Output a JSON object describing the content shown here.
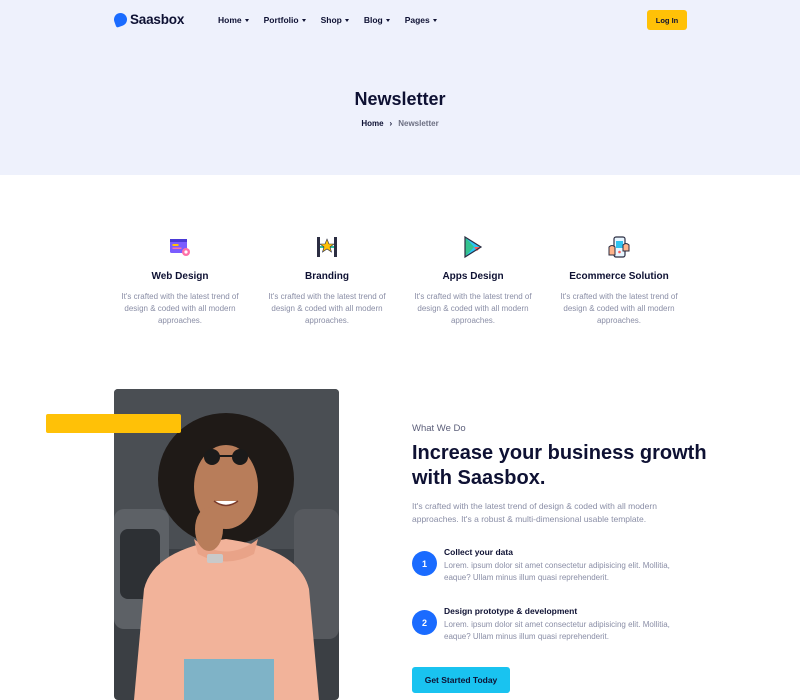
{
  "brand": {
    "name": "Saasbox",
    "color": "#1a6bff"
  },
  "nav": {
    "items": [
      {
        "label": "Home"
      },
      {
        "label": "Portfolio"
      },
      {
        "label": "Shop"
      },
      {
        "label": "Blog"
      },
      {
        "label": "Pages"
      }
    ],
    "login_label": "Log In"
  },
  "hero": {
    "title": "Newsletter",
    "breadcrumb": {
      "home": "Home",
      "separator": "›",
      "current": "Newsletter"
    }
  },
  "services": [
    {
      "icon": "web-design-icon",
      "title": "Web Design",
      "desc": "It's crafted with the latest trend of design & coded with all modern approaches."
    },
    {
      "icon": "branding-icon",
      "title": "Branding",
      "desc": "It's crafted with the latest trend of design & coded with all modern approaches."
    },
    {
      "icon": "apps-design-icon",
      "title": "Apps Design",
      "desc": "It's crafted with the latest trend of design & coded with all modern approaches."
    },
    {
      "icon": "ecommerce-icon",
      "title": "Ecommerce Solution",
      "desc": "It's crafted with the latest trend of design & coded with all modern approaches."
    }
  ],
  "about": {
    "eyebrow": "What We Do",
    "headline": "Increase your business growth with Saasbox.",
    "intro": "It's crafted with the latest trend of design & coded with all modern approaches. It's a robust & multi-dimensional usable template.",
    "steps": [
      {
        "num": "1",
        "title": "Collect your data",
        "desc": "Lorem. ipsum dolor sit amet consectetur adipisicing elit. Mollitia, eaque? Ullam minus illum quasi reprehenderit."
      },
      {
        "num": "2",
        "title": "Design prototype & development",
        "desc": "Lorem. ipsum dolor sit amet consectetur adipisicing elit. Mollitia, eaque? Ullam minus illum quasi reprehenderit."
      }
    ],
    "cta_label": "Get Started Today"
  },
  "colors": {
    "accent_yellow": "#ffc107",
    "accent_cyan": "#19c3f0",
    "header_bg": "#eef1fc",
    "step_blue": "#1a6bff"
  }
}
